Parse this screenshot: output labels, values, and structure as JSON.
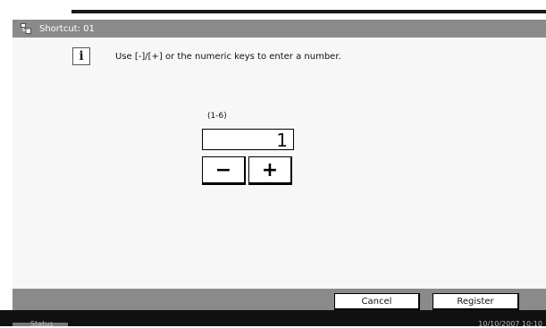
{
  "window": {
    "title": "Shortcut: 01",
    "icon": "shortcut-icon"
  },
  "info": {
    "icon": "info-icon",
    "message": "Use [-]/[+] or the numeric keys to enter a number."
  },
  "number_input": {
    "range_label": "(1-6)",
    "value": "1"
  },
  "stepper": {
    "minus_label": "−",
    "plus_label": "+"
  },
  "footer": {
    "cancel_label": "Cancel",
    "register_label": "Register"
  },
  "status_bar": {
    "status_label": "Status",
    "datetime": "10/10/2007   10:10"
  },
  "colors": {
    "title_bar": "#8a8a8a",
    "content_bg": "#f7f7f7",
    "status_bar": "#111111"
  }
}
